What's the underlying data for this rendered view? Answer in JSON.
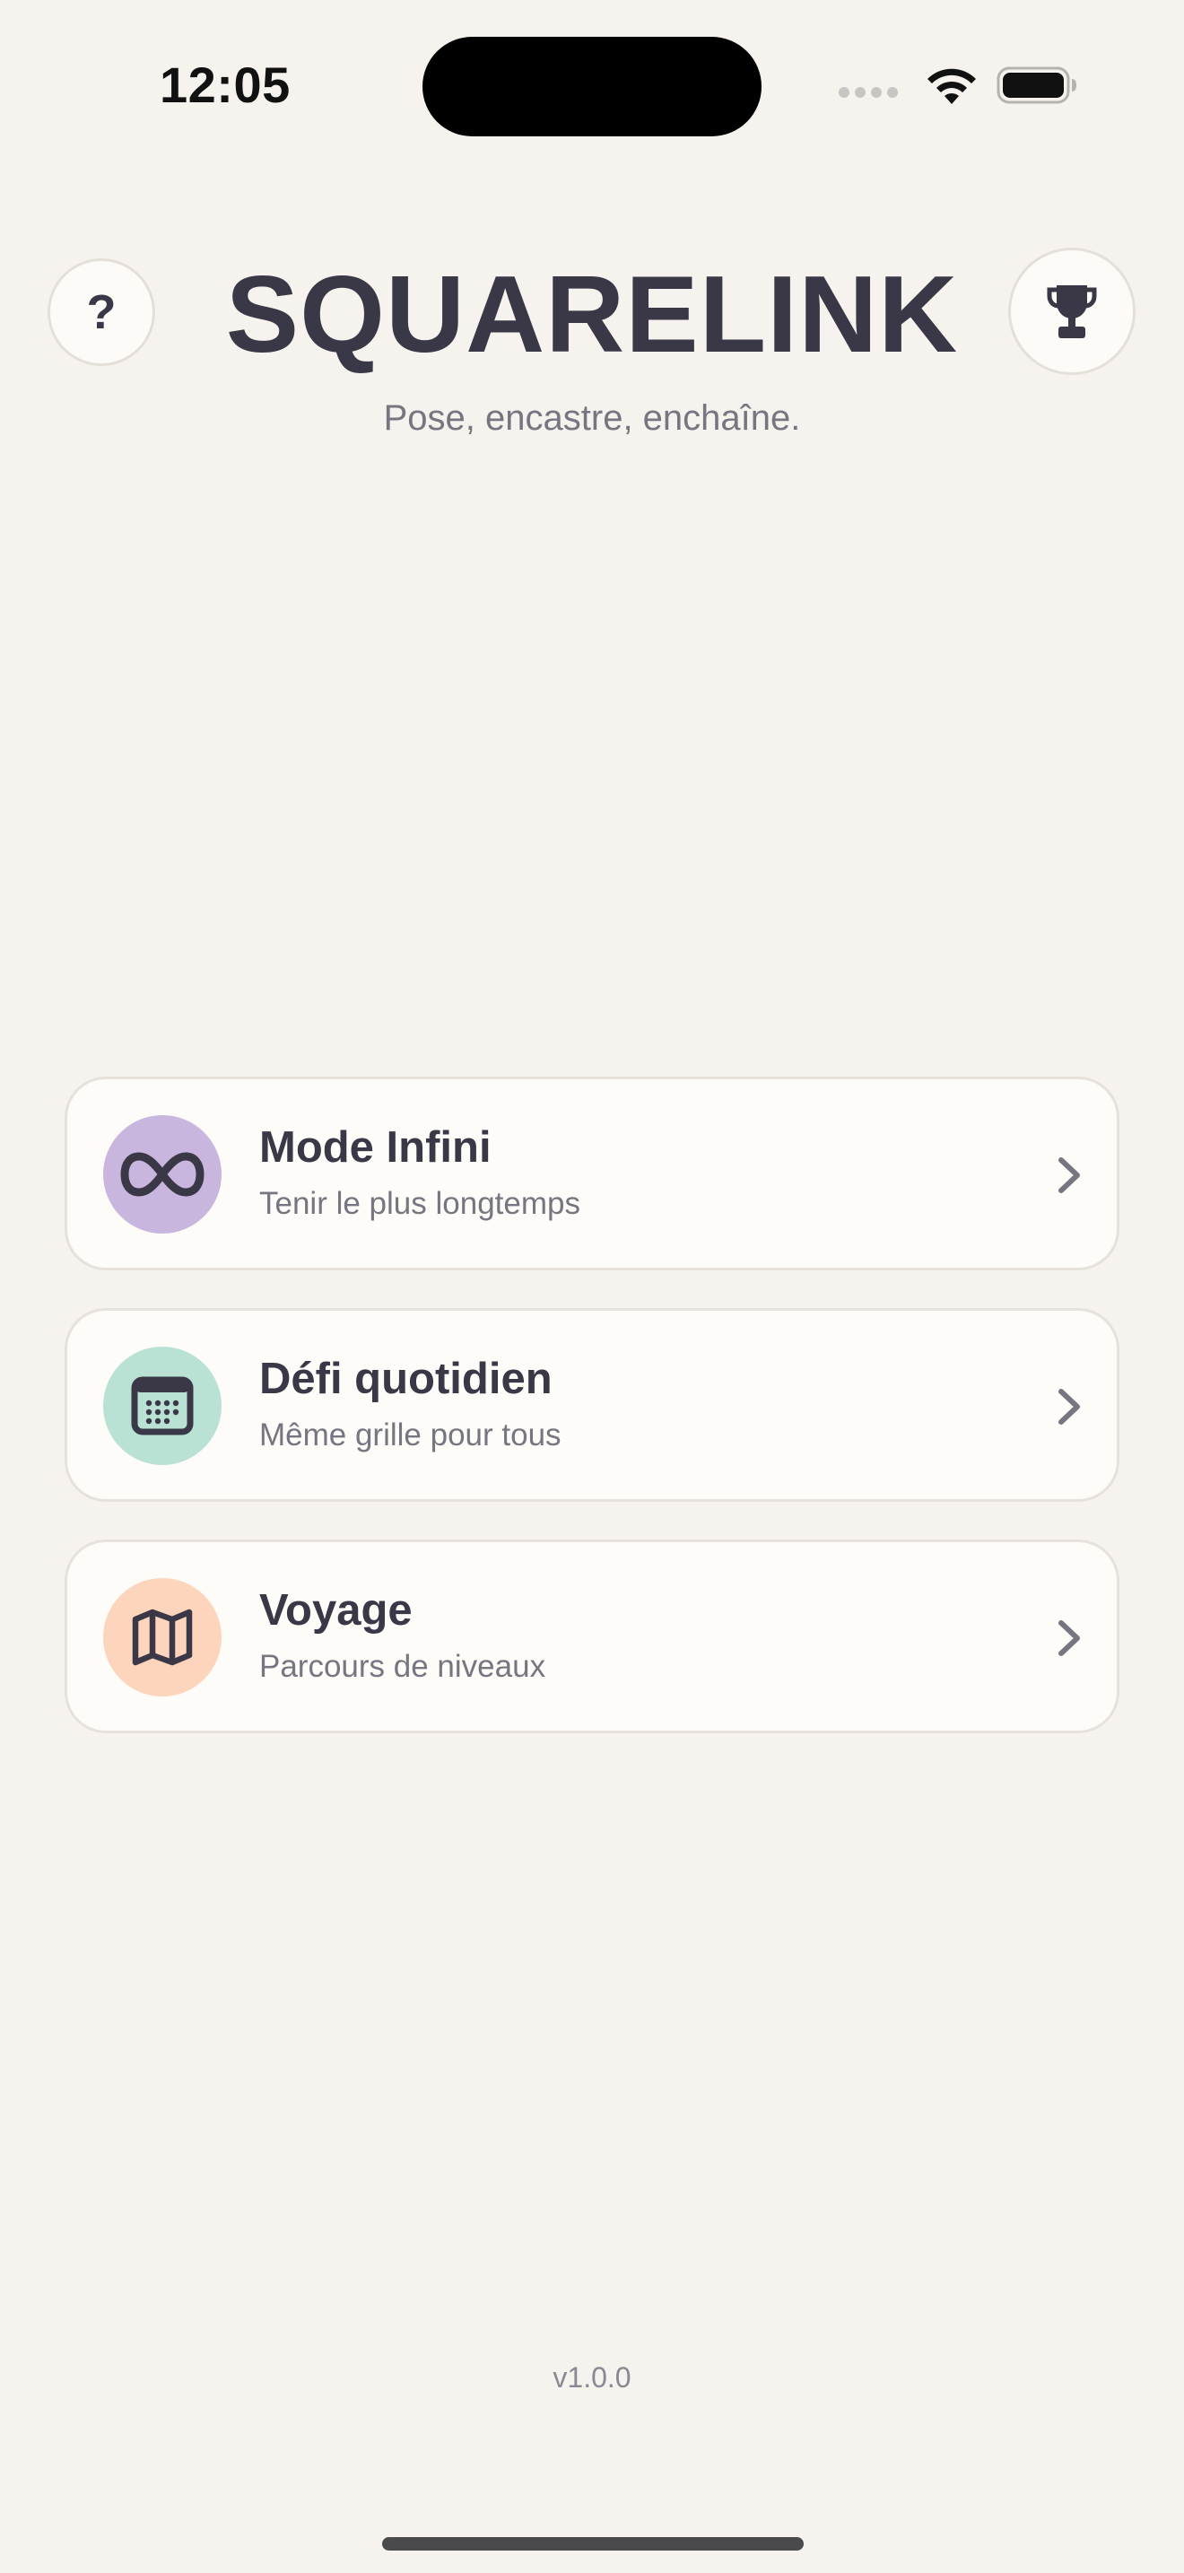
{
  "status_bar": {
    "time": "12:05",
    "icons": [
      "signal-icon",
      "wifi-icon",
      "battery-icon"
    ]
  },
  "header": {
    "help_icon": "?",
    "title": "SQUARELINK",
    "subtitle": "Pose, encastre, enchaîne.",
    "trophy_icon": "trophy-icon"
  },
  "modes": [
    {
      "title": "Mode Infini",
      "description": "Tenir le plus longtemps",
      "icon": "infinity-icon",
      "color": "#c9b6de"
    },
    {
      "title": "Défi quotidien",
      "description": "Même grille pour tous",
      "icon": "calendar-icon",
      "color": "#b9e2d4"
    },
    {
      "title": "Voyage",
      "description": "Parcours de niveaux",
      "icon": "map-icon",
      "color": "#fdd4bc"
    }
  ],
  "footer": {
    "version": "v1.0.0"
  },
  "colors": {
    "background": "#f6f3ee",
    "text_primary": "#3a3847",
    "text_secondary": "#77757f",
    "card_background": "#fefcf8"
  }
}
